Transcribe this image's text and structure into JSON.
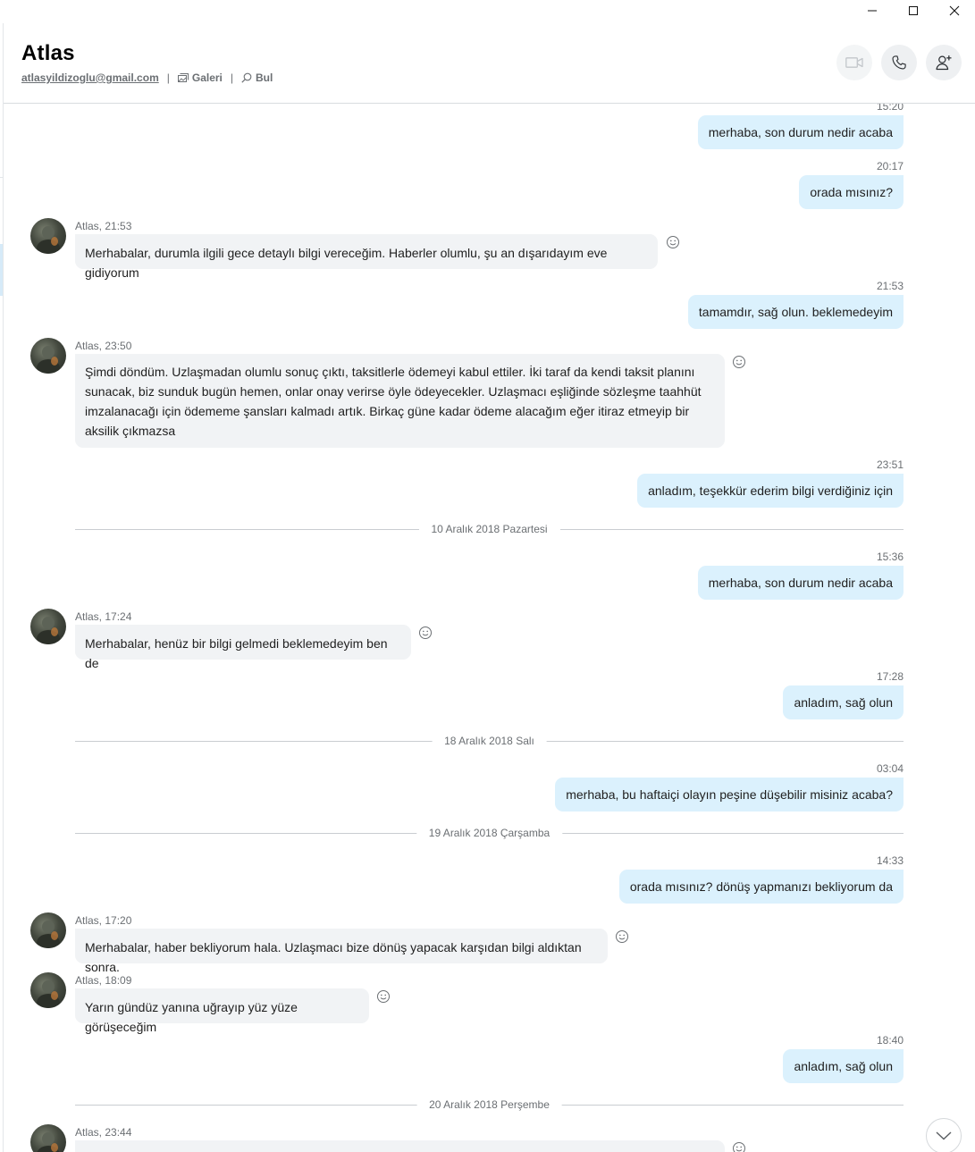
{
  "window": {
    "minimize_icon": "minimize-icon",
    "maximize_icon": "maximize-icon",
    "close_icon": "close-icon"
  },
  "header": {
    "title": "Atlas",
    "email": "atlasyildizoglu@gmail.com",
    "gallery_label": "Galeri",
    "find_label": "Bul",
    "actions": [
      "video-call-icon",
      "phone-call-icon",
      "add-person-icon"
    ]
  },
  "messages": [
    {
      "kind": "out",
      "time": "15:20",
      "text": "merhaba, son durum nedir acaba"
    },
    {
      "kind": "out",
      "time": "20:17",
      "text": "orada mısınız?"
    },
    {
      "kind": "in",
      "meta": "Atlas, 21:53",
      "text": "Merhabalar, durumla ilgili gece detaylı bilgi vereceğim. Haberler olumlu, şu an dışarıdayım eve gidiyorum"
    },
    {
      "kind": "out",
      "time": "21:53",
      "text": "tamamdır, sağ olun. beklemedeyim"
    },
    {
      "kind": "in",
      "meta": "Atlas, 23:50",
      "text": "Şimdi döndüm. Uzlaşmadan olumlu sonuç çıktı, taksitlerle ödemeyi kabul ettiler. İki taraf da kendi taksit planını sunacak, biz sunduk bugün hemen, onlar onay verirse öyle ödeyecekler. Uzlaşmacı eşliğinde sözleşme taahhüt imzalanacağı için ödememe şansları kalmadı artık. Birkaç güne kadar ödeme alacağım eğer itiraz etmeyip bir aksilik çıkmazsa"
    },
    {
      "kind": "out",
      "time": "23:51",
      "text": "anladım, teşekkür ederim bilgi verdiğiniz için"
    },
    {
      "kind": "date",
      "text": "10 Aralık 2018 Pazartesi"
    },
    {
      "kind": "out",
      "time": "15:36",
      "text": "merhaba, son durum nedir acaba"
    },
    {
      "kind": "in",
      "meta": "Atlas, 17:24",
      "text": "Merhabalar, henüz bir bilgi gelmedi beklemedeyim ben de"
    },
    {
      "kind": "out",
      "time": "17:28",
      "text": "anladım, sağ olun"
    },
    {
      "kind": "date",
      "text": "18 Aralık 2018 Salı"
    },
    {
      "kind": "out",
      "time": "03:04",
      "text": "merhaba, bu haftaiçi olayın peşine düşebilir misiniz acaba?"
    },
    {
      "kind": "date",
      "text": "19 Aralık 2018 Çarşamba"
    },
    {
      "kind": "out",
      "time": "14:33",
      "text": "orada mısınız? dönüş yapmanızı bekliyorum da"
    },
    {
      "kind": "in",
      "meta": "Atlas, 17:20",
      "text": "Merhabalar, haber bekliyorum hala. Uzlaşmacı bize dönüş yapacak karşıdan bilgi aldıktan sonra."
    },
    {
      "kind": "in",
      "meta": "Atlas, 18:09",
      "text": "Yarın gündüz yanına uğrayıp yüz yüze görüşeceğim"
    },
    {
      "kind": "out",
      "time": "18:40",
      "text": "anladım, sağ olun"
    },
    {
      "kind": "date",
      "text": "20 Aralık 2018 Perşembe"
    },
    {
      "kind": "in",
      "meta": "Atlas, 23:44",
      "text": ""
    }
  ],
  "scroll_down_icon": "chevron-down-icon",
  "colors": {
    "outgoing_bubble": "#dbf1fd",
    "incoming_bubble": "#f1f3f5",
    "muted_text": "#6b6f73"
  }
}
